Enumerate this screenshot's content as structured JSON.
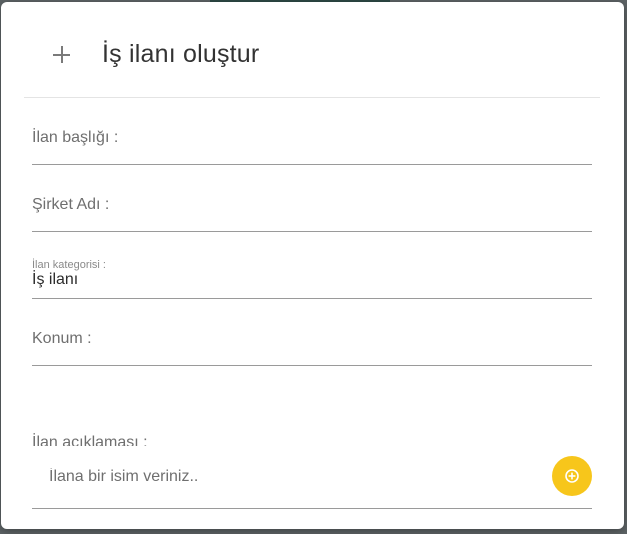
{
  "dialog": {
    "title": "İş ilanı oluştur",
    "header_icon": "plus-icon"
  },
  "form": {
    "fields": [
      {
        "label": "İlan başlığı :",
        "value": ""
      },
      {
        "label": "Şirket Adı :",
        "value": ""
      },
      {
        "label": "İlan kategorisi :",
        "value": "İş ilanı"
      },
      {
        "label": "Konum :",
        "value": ""
      }
    ],
    "description_label": "İlan açıklaması :",
    "name_input": {
      "placeholder": "İlana bir isim veriniz..",
      "value": ""
    },
    "add_button_icon": "add-circle-icon"
  },
  "colors": {
    "accent": "#f7c61b",
    "title_text": "#333333",
    "label_text": "#6f6f6f",
    "underline": "#9a9a9a"
  }
}
